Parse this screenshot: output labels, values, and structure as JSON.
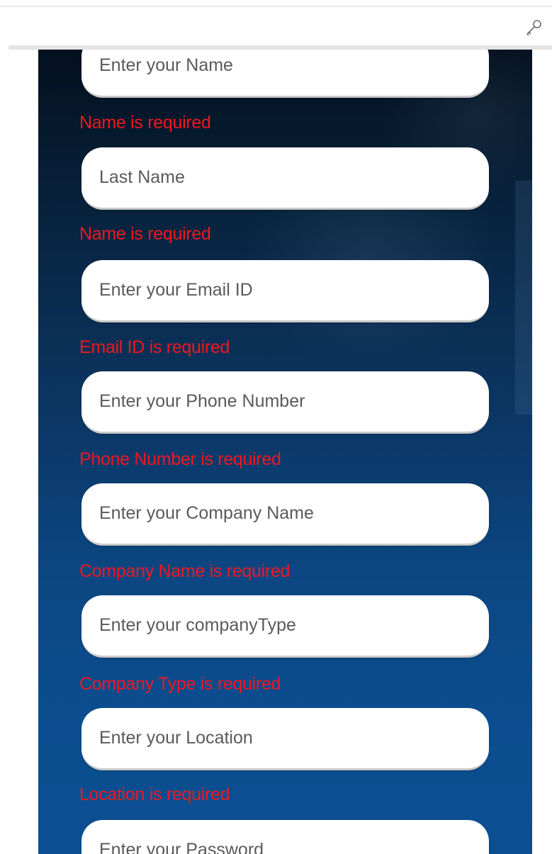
{
  "form": {
    "fields": [
      {
        "placeholder": "Enter your Name",
        "error": "Name is required"
      },
      {
        "placeholder": "Last Name",
        "error": "Name is required"
      },
      {
        "placeholder": "Enter your Email ID",
        "error": "Email ID is required"
      },
      {
        "placeholder": "Enter your Phone Number",
        "error": "Phone Number is required"
      },
      {
        "placeholder": "Enter your Company Name",
        "error": "Company Name is required"
      },
      {
        "placeholder": "Enter your companyType",
        "error": "Company Type is required"
      },
      {
        "placeholder": "Enter your Location",
        "error": "Location is required"
      },
      {
        "placeholder": "Enter your Password"
      }
    ]
  },
  "icons": {
    "toolbar": "key-icon"
  },
  "colors": {
    "error": "#f2161f",
    "panel_top": "#03101f",
    "panel_bottom": "#0b4f92"
  }
}
